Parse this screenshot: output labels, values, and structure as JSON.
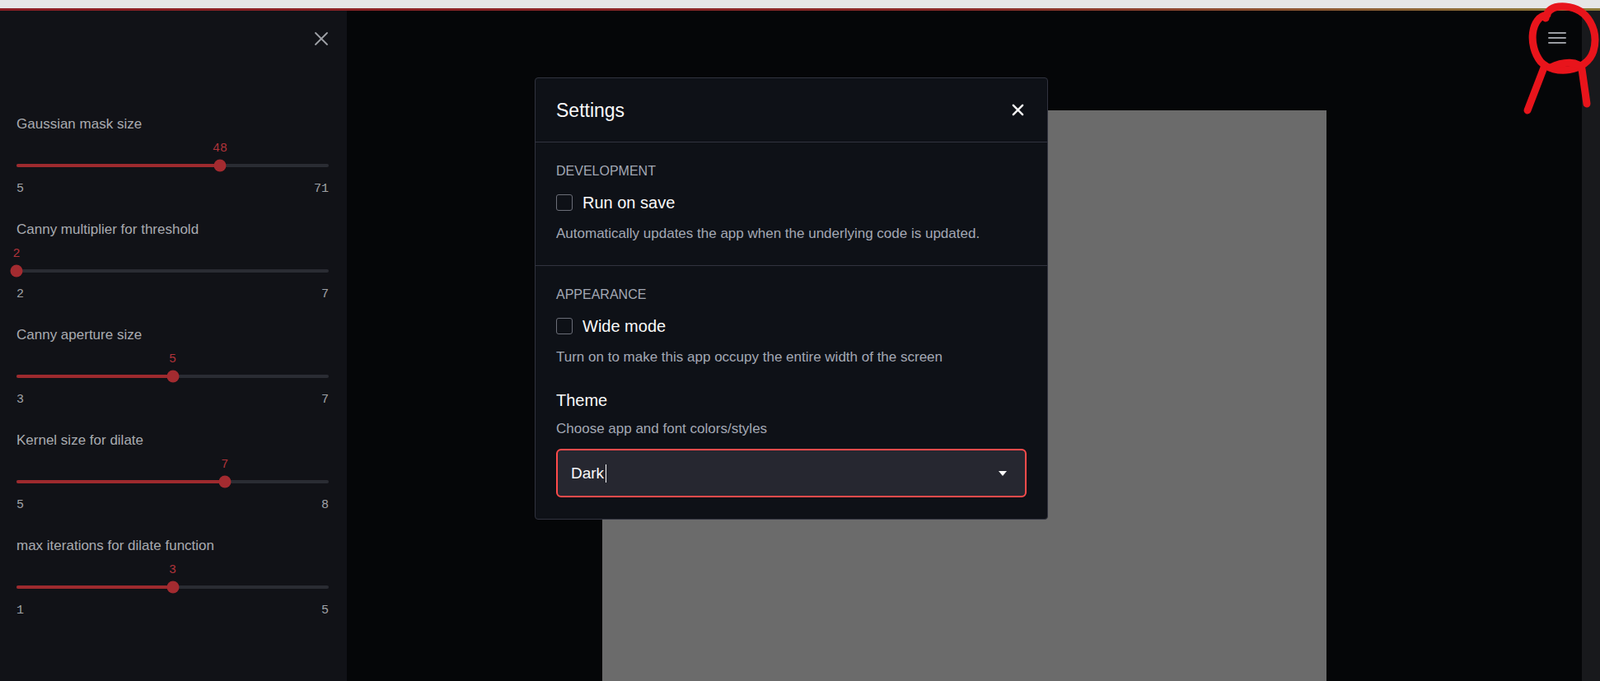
{
  "sidebar": {
    "sliders": [
      {
        "label": "Gaussian mask size",
        "value": "48",
        "min": "5",
        "max": "71",
        "level": 0.652
      },
      {
        "label": "Canny multiplier for threshold",
        "value": "2",
        "min": "2",
        "max": "7",
        "level": 0
      },
      {
        "label": "Canny aperture size",
        "value": "5",
        "min": "3",
        "max": "7",
        "level": 0.5
      },
      {
        "label": "Kernel size for dilate",
        "value": "7",
        "min": "5",
        "max": "8",
        "level": 0.667
      },
      {
        "label": "max iterations for dilate function",
        "value": "3",
        "min": "1",
        "max": "5",
        "level": 0.5
      }
    ]
  },
  "settings_dialog": {
    "title": "Settings",
    "sections": [
      {
        "heading": "DEVELOPMENT",
        "items": [
          {
            "kind": "checkbox",
            "label": "Run on save",
            "checked": false,
            "description": "Automatically updates the app when the underlying code is updated."
          }
        ]
      },
      {
        "heading": "APPEARANCE",
        "items": [
          {
            "kind": "checkbox",
            "label": "Wide mode",
            "checked": false,
            "description": "Turn on to make this app occupy the entire width of the screen"
          },
          {
            "kind": "select",
            "label": "Theme",
            "description": "Choose app and font colors/styles",
            "value": "Dark",
            "focused": true
          }
        ]
      }
    ]
  }
}
